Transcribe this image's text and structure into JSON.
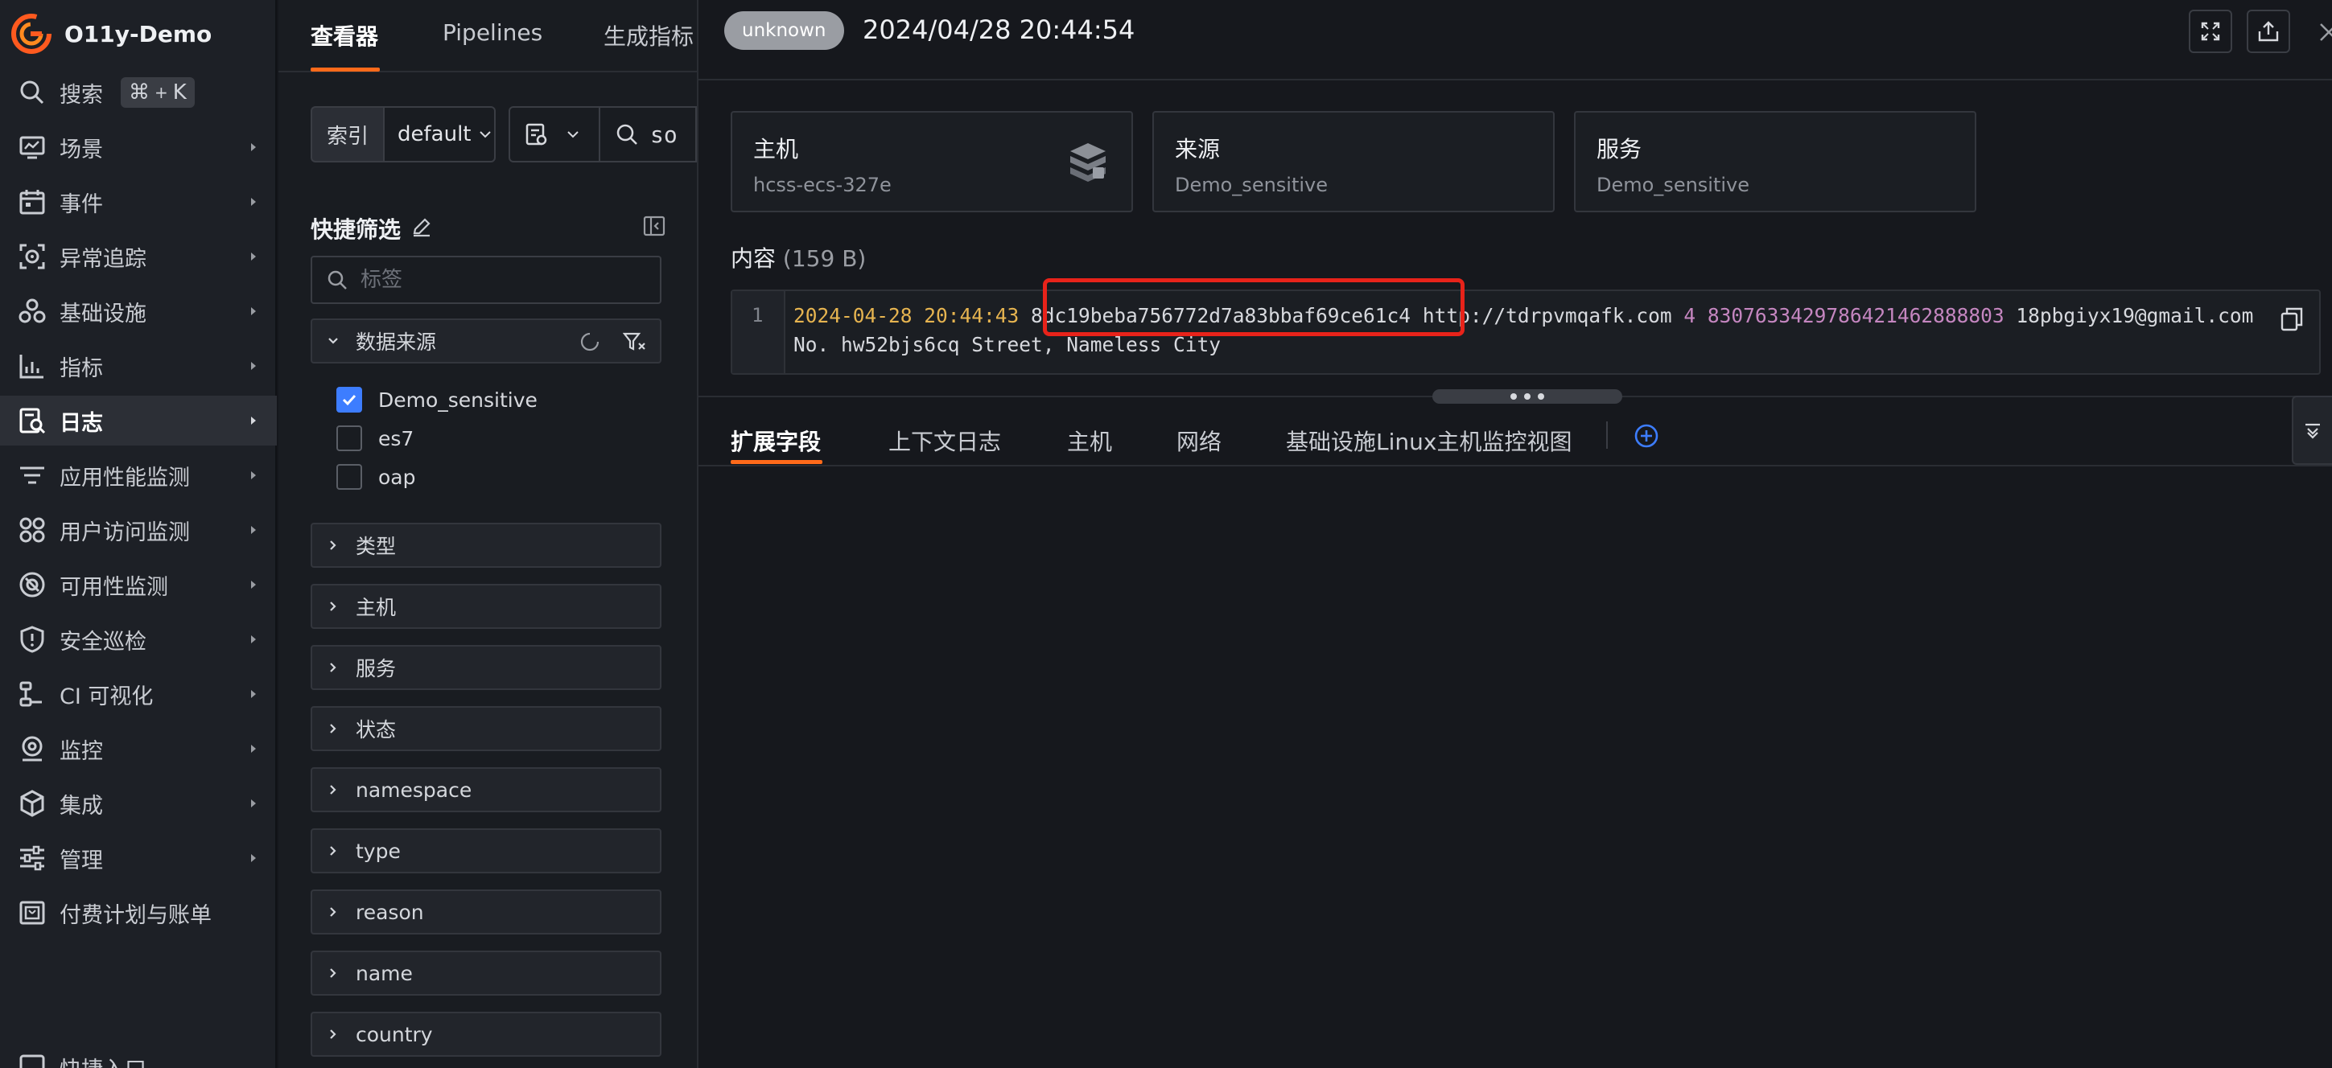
{
  "brand": {
    "title": "O11y-Demo"
  },
  "nav": {
    "search_label": "搜索",
    "search_shortcut_symbol": "⌘",
    "search_shortcut_plus": "+",
    "search_shortcut_key": "K",
    "items": [
      {
        "label": "场景",
        "icon": "monitor-icon"
      },
      {
        "label": "事件",
        "icon": "calendar-icon"
      },
      {
        "label": "异常追踪",
        "icon": "target-icon"
      },
      {
        "label": "基础设施",
        "icon": "cluster-icon"
      },
      {
        "label": "指标",
        "icon": "chart-icon"
      },
      {
        "label": "日志",
        "icon": "log-search-icon",
        "active": true
      },
      {
        "label": "应用性能监测",
        "icon": "filter-lines-icon"
      },
      {
        "label": "用户访问监测",
        "icon": "grid-icon"
      },
      {
        "label": "可用性监测",
        "icon": "gauge-icon"
      },
      {
        "label": "安全巡检",
        "icon": "shield-icon"
      },
      {
        "label": "CI 可视化",
        "icon": "pipeline-icon"
      },
      {
        "label": "监控",
        "icon": "camera-icon"
      },
      {
        "label": "集成",
        "icon": "cube-icon"
      },
      {
        "label": "管理",
        "icon": "sliders-icon"
      },
      {
        "label": "付费计划与账单",
        "icon": "bill-icon"
      }
    ],
    "bottom_partial": "快捷入口"
  },
  "explorer": {
    "tabs": [
      "查看器",
      "Pipelines",
      "生成指标"
    ],
    "active_tab": 0,
    "index_label": "索引",
    "index_value": "default",
    "query_text": "so"
  },
  "quick_filter": {
    "title": "快捷筛选",
    "search_placeholder": "标签",
    "data_source": {
      "label": "数据来源",
      "options": [
        {
          "label": "Demo_sensitive",
          "checked": true
        },
        {
          "label": "es7",
          "checked": false
        },
        {
          "label": "oap",
          "checked": false
        }
      ]
    },
    "facets": [
      "类型",
      "主机",
      "服务",
      "状态",
      "namespace",
      "type",
      "reason",
      "name",
      "country"
    ]
  },
  "detail": {
    "status": "unknown",
    "time": "2024/04/28 20:44:54",
    "cards": [
      {
        "title": "主机",
        "value": "hcss-ecs-327e"
      },
      {
        "title": "来源",
        "value": "Demo_sensitive"
      },
      {
        "title": "服务",
        "value": "Demo_sensitive"
      }
    ],
    "content_label": "内容",
    "content_size": "(159 B)",
    "line_number": "1",
    "log": {
      "timestamp": "2024-04-28 20:44:43",
      "hash": "8dc19beba756772d7a83bbaf69ce61c4",
      "url": "http://tdrpvmqafk.com",
      "num1": "4",
      "num2": "8307633429786421462888803",
      "email": "18pbgiyx19@gmail.com",
      "line2": "No. hw52bjs6cq Street, Nameless City"
    },
    "tabs": [
      "扩展字段",
      "上下文日志",
      "主机",
      "网络",
      "基础设施Linux主机监控视图"
    ],
    "active_tab": 0
  },
  "colors": {
    "accent": "#ff6a1a",
    "highlight_box": "#e8231a",
    "checkbox": "#3d7dff",
    "timestamp": "#e6b450",
    "number": "#c586c0"
  }
}
